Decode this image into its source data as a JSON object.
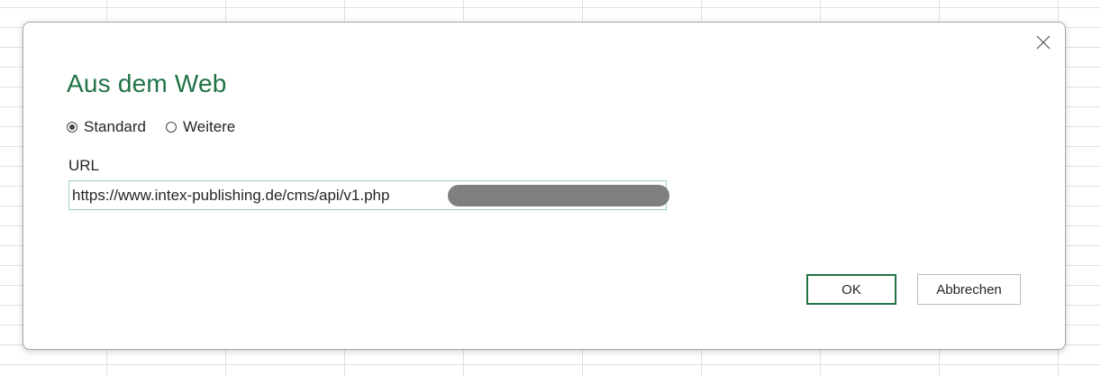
{
  "dialog": {
    "title": "Aus dem Web",
    "close_icon": "close-icon",
    "mode_options": [
      {
        "label": "Standard",
        "selected": true
      },
      {
        "label": "Weitere",
        "selected": false
      }
    ],
    "url_label": "URL",
    "url_value": "https://www.intex-publishing.de/cms/api/v1.php",
    "ok_label": "OK",
    "cancel_label": "Abbrechen"
  },
  "colors": {
    "accent": "#217346",
    "input_border": "#9ed0b5",
    "redaction": "#7f7f7f"
  }
}
